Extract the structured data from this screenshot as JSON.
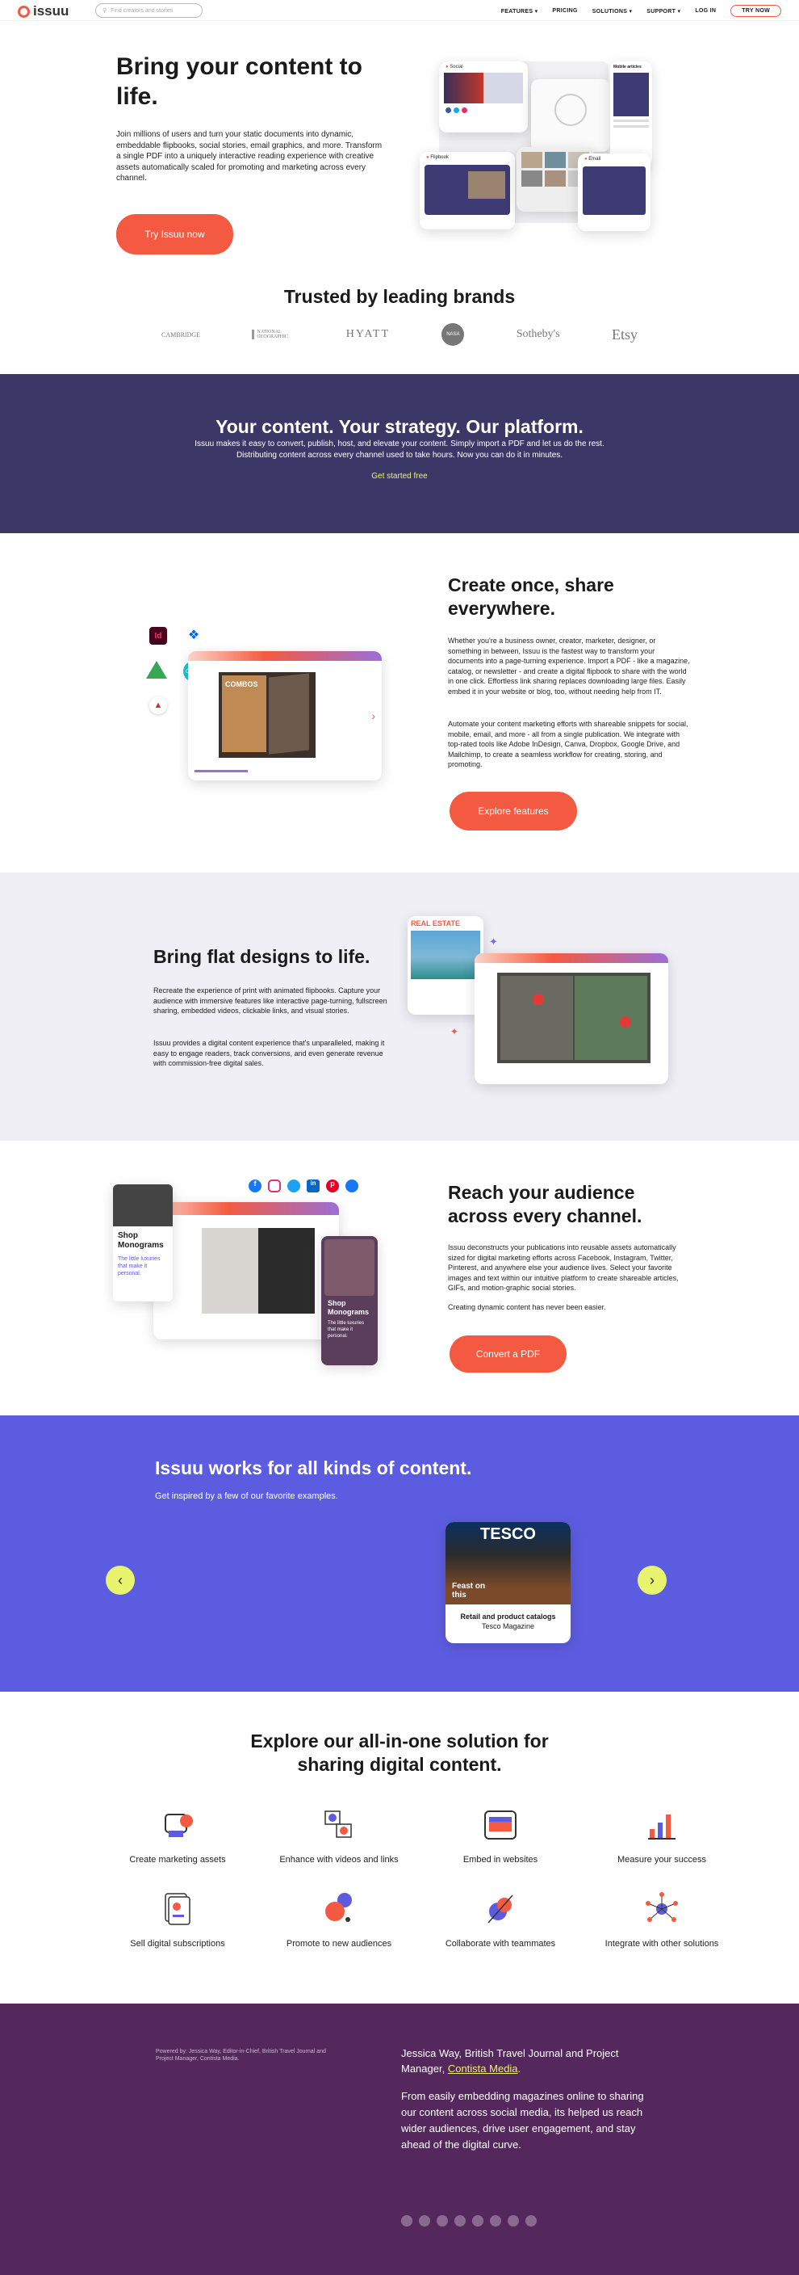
{
  "nav": {
    "logo_text": "issuu",
    "search_placeholder": "Find creators and stories",
    "links": [
      "FEATURES",
      "PRICING",
      "SOLUTIONS",
      "SUPPORT",
      "LOG IN"
    ],
    "cta": "TRY NOW"
  },
  "hero": {
    "title": "Bring your content to life.",
    "body": "Join millions of users and turn your static documents into dynamic, embeddable flipbooks, social stories, email graphics, and more. Transform a single PDF into a uniquely interactive reading experience with creative assets automatically scaled for promoting and marketing across every channel.",
    "cta": "Try Issuu now",
    "mock_labels": [
      "Social",
      "Flipbook",
      "Email",
      "Mobile articles"
    ]
  },
  "trusted": {
    "title": "Trusted by leading brands",
    "brands": [
      "CAMBRIDGE",
      "NATIONAL GEOGRAPHIC",
      "HYATT",
      "NASA",
      "Sotheby's",
      "Etsy"
    ]
  },
  "platform": {
    "title": "Your content. Your strategy. Our platform.",
    "body": "Issuu makes it easy to convert, publish, host, and elevate your content. Simply import a PDF and let us do the rest. Distributing content across every channel used to take hours. Now you can do it in minutes.",
    "link": "Get started free"
  },
  "create": {
    "title": "Create once, share everywhere.",
    "body1": "Whether you're a business owner, creator, marketer, designer, or something in between, Issuu is the fastest way to transform your documents into a page-turning experience. Import a PDF - like a magazine, catalog, or newsletter - and create a digital flipbook to share with the world in one click. Effortless link sharing replaces downloading large files. Easily embed it in your website or blog, too, without needing help from IT.",
    "body2": "Automate your content marketing efforts with shareable snippets for social, mobile, email, and more - all from a single publication. We integrate with top-rated tools like Adobe InDesign, Canva, Dropbox, Google Drive, and Mailchimp, to create a seamless workflow for creating, storing, and promoting.",
    "cta": "Explore features",
    "mock_cover": "COMBOS"
  },
  "flat": {
    "title": "Bring flat designs to life.",
    "body1": "Recreate the experience of print with animated flipbooks. Capture your audience with immersive features like interactive page-turning, fullscreen sharing, embedded videos, clickable links, and visual stories.",
    "body2": "Issuu provides a digital content experience that's unparalleled, making it easy to engage readers, track conversions, and even generate revenue with commission-free digital sales.",
    "mock_cover": "REAL ESTATE"
  },
  "reach": {
    "title": "Reach your audience across every channel.",
    "body1": "Issuu deconstructs your publications into reusable assets automatically sized for digital marketing efforts across Facebook, Instagram, Twitter, Pinterest, and anywhere else your audience lives. Select your favorite images and text within our intuitive platform to create shareable articles, GIFs, and motion-graphic social stories.",
    "body2": "Creating dynamic content has never been easier.",
    "cta": "Convert a PDF",
    "mock_title": "Shop Monograms",
    "mock_sub": "The little luxuries that make it personal.",
    "mock_title2": "Shop Monograms",
    "mock_sub2": "The little luxuries that make it personal."
  },
  "kinds": {
    "title": "Issuu works for all kinds of content.",
    "sub": "Get inspired by a few of our favorite examples.",
    "card_brand": "TESCO",
    "card_cover": "Feast on this",
    "card_title": "Retail and product catalogs",
    "card_sub": "Tesco Magazine"
  },
  "explore": {
    "title": "Explore our all-in-one solution for sharing digital content.",
    "features": [
      {
        "label": "Create marketing assets",
        "icon": "marketing-assets-icon"
      },
      {
        "label": "Enhance with videos and links",
        "icon": "video-links-icon"
      },
      {
        "label": "Embed in websites",
        "icon": "embed-icon"
      },
      {
        "label": "Measure your success",
        "icon": "chart-icon"
      },
      {
        "label": "Sell digital subscriptions",
        "icon": "subscriptions-icon"
      },
      {
        "label": "Promote to new audiences",
        "icon": "megaphone-icon"
      },
      {
        "label": "Collaborate with teammates",
        "icon": "collaborate-icon"
      },
      {
        "label": "Integrate with other solutions",
        "icon": "integrate-icon"
      }
    ]
  },
  "testimonial": {
    "caption": "Powered by: Jessica Way, Editor-in-Chief, British Travel Journal and Project Manager, Contista Media.",
    "name": "Jessica Way, British Travel Journal and Project Manager,",
    "company": "Contista Media",
    "quote": "From easily embedding magazines online to sharing our content across social media, its helped us reach wider audiences, drive user engagement, and stay ahead of the digital curve."
  },
  "colors": {
    "coral": "#f35a41",
    "navy": "#3b3766",
    "periwinkle": "#5c5ce0",
    "plum": "#54285c",
    "lime": "#e9f46e"
  }
}
